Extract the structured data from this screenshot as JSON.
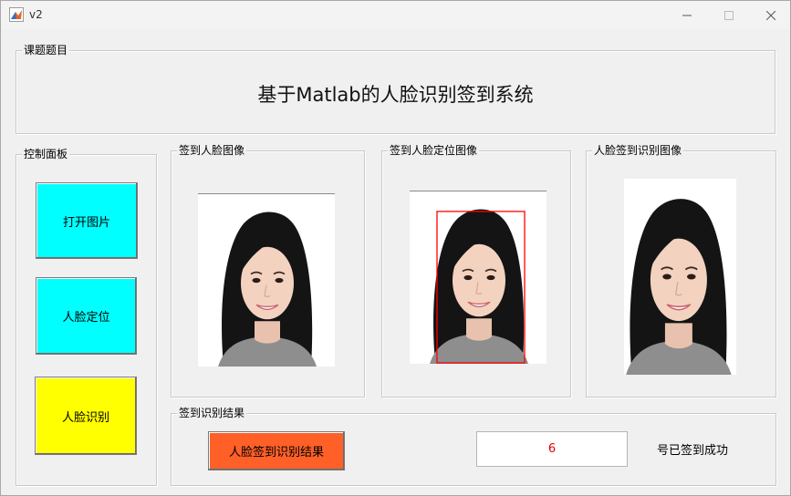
{
  "window": {
    "title": "v2"
  },
  "topic_panel": {
    "legend": "课题题目",
    "title": "基于Matlab的人脸识别签到系统"
  },
  "control_panel": {
    "legend": "控制面板",
    "open_image_label": "打开图片",
    "face_locate_label": "人脸定位",
    "face_recognize_label": "人脸识别"
  },
  "image_panels": {
    "checkin_face": "签到人脸图像",
    "checkin_located": "签到人脸定位图像",
    "checkin_recognized": "人脸签到识别图像"
  },
  "result_panel": {
    "legend": "签到识别结果",
    "result_button_label": "人脸签到识别结果",
    "result_value": "6",
    "result_suffix": "号已签到成功"
  },
  "colors": {
    "cyan_button": "#00ffff",
    "yellow_button": "#ffff00",
    "orange_button": "#ff6028",
    "result_text": "#e00000",
    "locate_box": "#ff0000"
  },
  "icons": {
    "app": "matlab-logo-icon",
    "minimize": "minimize-icon",
    "maximize": "maximize-icon",
    "close": "close-icon"
  }
}
